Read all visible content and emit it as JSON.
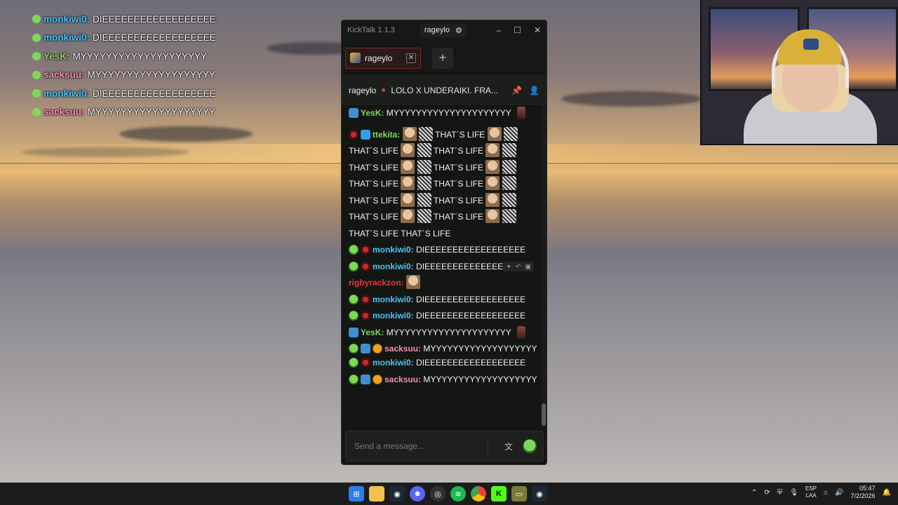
{
  "overlay_chat": [
    {
      "user": "monkiwi0:",
      "user_color": "#4fc3f7",
      "text": "DIEEEEEEEEEEEEEEEEEE"
    },
    {
      "user": "monkiwi0:",
      "user_color": "#4fc3f7",
      "text": "DIEEEEEEEEEEEEEEEEEE"
    },
    {
      "user": "YesK:",
      "user_color": "#9ccc65",
      "text": "MYYYYYYYYYYYYYYYYYYYY"
    },
    {
      "user": "sacksuu:",
      "user_color": "#f48fb1",
      "text": "MYYYYYYYYYYYYYYYYYYY"
    },
    {
      "user": "monkiwi0:",
      "user_color": "#4fc3f7",
      "text": "DIEEEEEEEEEEEEEEEEEE"
    },
    {
      "user": "sacksuu:",
      "user_color": "#f48fb1",
      "text": "MYYYYYYYYYYYYYYYYYYY"
    }
  ],
  "app": {
    "title": "KickTalk 1.1.3",
    "current_user": "rageylo",
    "settings_icon": "gear-icon",
    "window_controls": {
      "minimize": "–",
      "maximize": "☐",
      "close": "✕"
    }
  },
  "tabs": [
    {
      "label": "rageylo",
      "close": "✕"
    }
  ],
  "add_tab_label": "+",
  "channel": {
    "name": "rageylo",
    "stream_title": "LOLO X UNDERAIKI. FRA...",
    "icons": [
      "pin-icon",
      "user-icon"
    ]
  },
  "chat": {
    "messages": [
      {
        "id": "m1",
        "user": "YesK:",
        "color": "#7ed957",
        "badges": [
          "hammer"
        ],
        "text": "MYYYYYYYYYYYYYYYYYYYYY"
      },
      {
        "id": "m2",
        "user": "ttekita:",
        "color": "#7ed957",
        "badges": [
          "mouth",
          "cube"
        ],
        "text": "THAT´S LIFE"
      },
      {
        "id": "m3",
        "user": "monkiwi0:",
        "color": "#4fc3f7",
        "badges": [
          "alien",
          "mouth"
        ],
        "text": "DIEEEEEEEEEEEEEEEEEE"
      },
      {
        "id": "m4",
        "user": "monkiwi0:",
        "color": "#4fc3f7",
        "badges": [
          "alien",
          "mouth"
        ],
        "text": "DIEEEEEEEEEEEEEEEEEE"
      },
      {
        "id": "m5",
        "user": "rigbyrackzon:",
        "color": "#e53935",
        "badges": [],
        "text": ""
      },
      {
        "id": "m6",
        "user": "monkiwi0:",
        "color": "#4fc3f7",
        "badges": [
          "alien",
          "mouth"
        ],
        "text": "DIEEEEEEEEEEEEEEEEEE"
      },
      {
        "id": "m7",
        "user": "monkiwi0:",
        "color": "#4fc3f7",
        "badges": [
          "alien",
          "mouth"
        ],
        "text": "DIEEEEEEEEEEEEEEEEEE"
      },
      {
        "id": "m8",
        "user": "YesK:",
        "color": "#7ed957",
        "badges": [
          "hammer"
        ],
        "text": "MYYYYYYYYYYYYYYYYYYYYY"
      },
      {
        "id": "m9",
        "user": "sacksuu:",
        "color": "#f48fb1",
        "badges": [
          "alien",
          "hammer",
          "smile"
        ],
        "text": "MYYYYYYYYYYYYYYYYYYY"
      },
      {
        "id": "m10",
        "user": "monkiwi0:",
        "color": "#4fc3f7",
        "badges": [
          "alien",
          "mouth"
        ],
        "text": "DIEEEEEEEEEEEEEEEEEE"
      },
      {
        "id": "m11",
        "user": "sacksuu:",
        "color": "#f48fb1",
        "badges": [
          "alien",
          "hammer",
          "smile"
        ],
        "text": "MYYYYYYYYYYYYYYYYYYY"
      }
    ],
    "repeated_phrase": "THAT´S LIFE"
  },
  "input": {
    "placeholder": "Send a message...",
    "buttons": [
      "translate-icon",
      "emote-picker-icon"
    ]
  },
  "taskbar": {
    "apps": [
      "start",
      "file-explorer",
      "steam",
      "discord",
      "obs",
      "spotify",
      "chrome",
      "kick",
      "app",
      "steam"
    ],
    "lang_top": "ESP",
    "lang_bottom": "LAA",
    "time": "05:47",
    "date": "7/2/2026"
  },
  "colors": {
    "window_bg": "#141614",
    "accent_red": "#7a2a2a",
    "kick_green": "#53fc18"
  }
}
